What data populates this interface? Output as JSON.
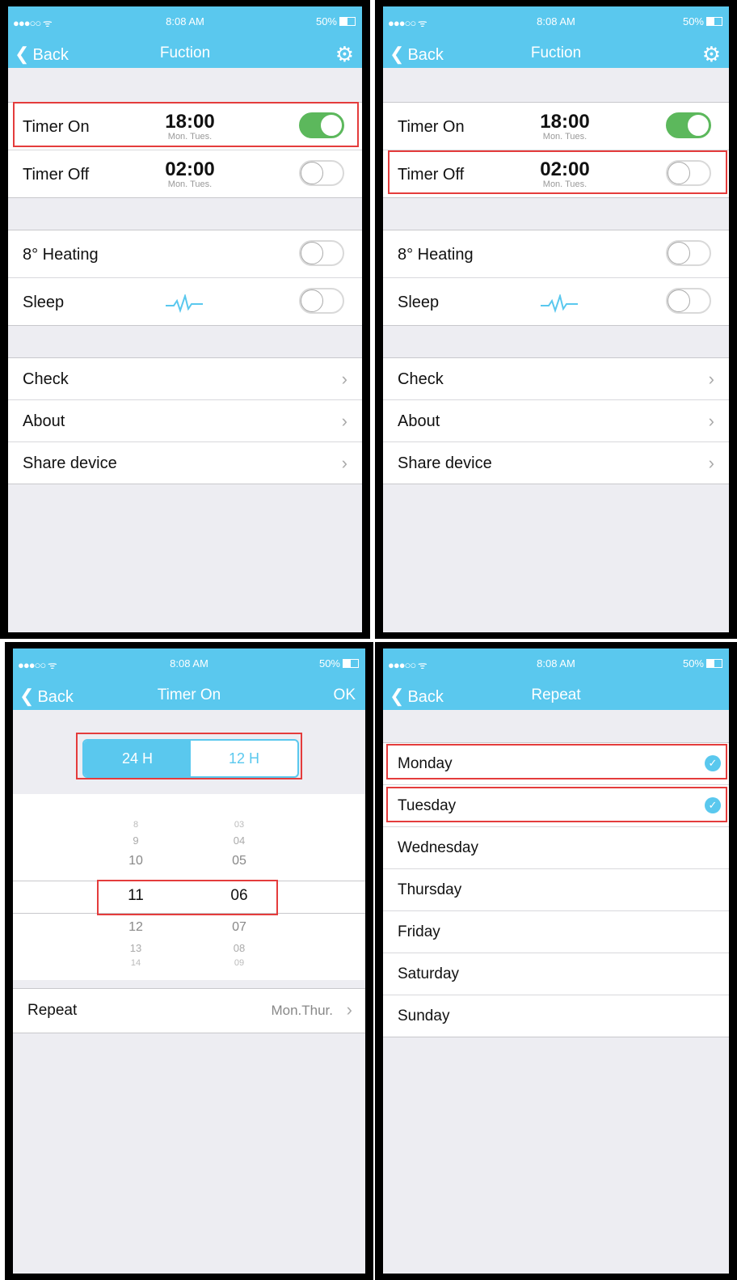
{
  "status": {
    "signal": "●●●○○ ᯤ",
    "time": "8:08 AM",
    "battery": "50%"
  },
  "function_screen": {
    "back": "Back",
    "title": "Fuction",
    "timers": [
      {
        "label": "Timer On",
        "time": "18:00",
        "days": "Mon. Tues.",
        "on": true
      },
      {
        "label": "Timer Off",
        "time": "02:00",
        "days": "Mon. Tues.",
        "on": false
      }
    ],
    "modes": [
      {
        "label": "8° Heating",
        "on": false
      },
      {
        "label": "Sleep",
        "on": false
      }
    ],
    "links": [
      "Check",
      "About",
      "Share device"
    ]
  },
  "timer_screen": {
    "back": "Back",
    "title": "Timer On",
    "ok": "OK",
    "format_options": [
      "24 H",
      "12 H"
    ],
    "selected_format": "24 H",
    "hours": [
      "8",
      "9",
      "10",
      "11",
      "12",
      "13",
      "14"
    ],
    "minutes": [
      "03",
      "04",
      "05",
      "06",
      "07",
      "08",
      "09"
    ],
    "selected_hour": "11",
    "selected_minute": "06",
    "repeat_label": "Repeat",
    "repeat_value": "Mon.Thur."
  },
  "repeat_screen": {
    "back": "Back",
    "title": "Repeat",
    "days": [
      {
        "label": "Monday",
        "checked": true
      },
      {
        "label": "Tuesday",
        "checked": true
      },
      {
        "label": "Wednesday",
        "checked": false
      },
      {
        "label": "Thursday",
        "checked": false
      },
      {
        "label": "Friday",
        "checked": false
      },
      {
        "label": "Saturday",
        "checked": false
      },
      {
        "label": "Sunday",
        "checked": false
      }
    ]
  },
  "colors": {
    "accent": "#5ac8ee",
    "toggle_on": "#5cb85c",
    "highlight": "#e43c3c",
    "background": "#ededf2"
  }
}
